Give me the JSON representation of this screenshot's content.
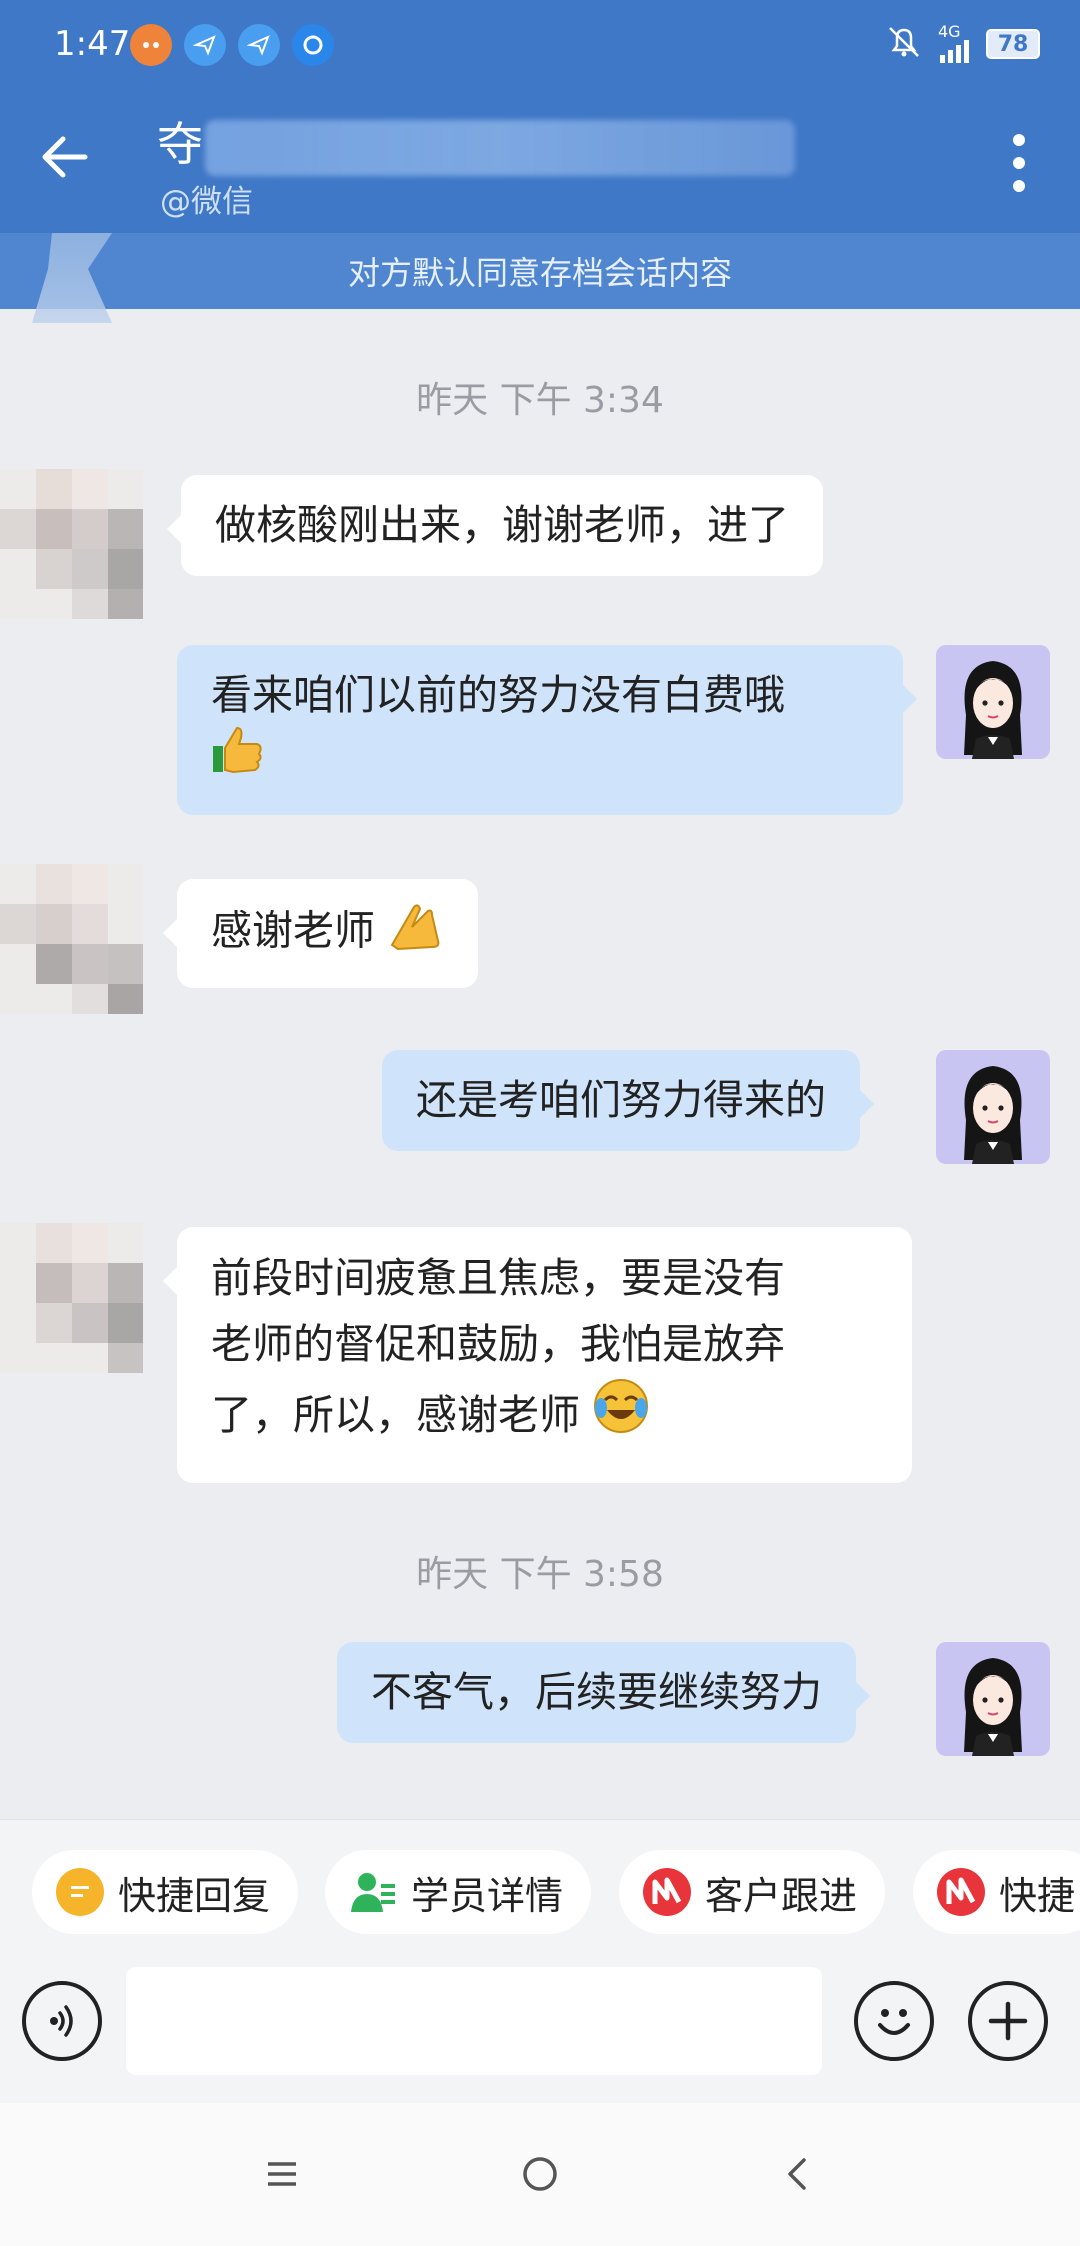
{
  "status_bar": {
    "time": "1:47",
    "network": "4G",
    "battery": "78"
  },
  "header": {
    "contact_name": "夺",
    "source": "@微信",
    "archive_notice": "对方默认同意存档会话内容"
  },
  "chat": {
    "dividers": [
      "昨天  下午 3:34",
      "昨天  下午 3:58"
    ],
    "messages": [
      {
        "direction": "in",
        "text": "做核酸刚出来，谢谢老师，进了"
      },
      {
        "direction": "out",
        "text": "看来咱们以前的努力没有白费哦",
        "emoji": "👍"
      },
      {
        "direction": "in",
        "text": "感谢老师",
        "emoji": "🙏"
      },
      {
        "direction": "out",
        "text": "还是考咱们努力得来的"
      },
      {
        "direction": "in",
        "line1": "前段时间疲惫且焦虑，要是没有",
        "line2": "老师的督促和鼓励，我怕是放弃",
        "line3": "了，所以，感谢老师",
        "emoji": "😭"
      },
      {
        "direction": "out",
        "text": "不客气，后续要继续努力"
      }
    ]
  },
  "quick_actions": [
    {
      "label": "快捷回复",
      "icon": "quick-reply-icon",
      "color": "#f6b42a"
    },
    {
      "label": "学员详情",
      "icon": "student-icon",
      "color": "#2fb35a"
    },
    {
      "label": "客户跟进",
      "icon": "follow-up-icon",
      "color": "#e8343b"
    },
    {
      "label": "快捷",
      "icon": "quick-icon",
      "color": "#e8343b"
    }
  ],
  "input": {
    "value": "",
    "placeholder": ""
  },
  "colors": {
    "header": "#3f78c6",
    "incoming_bubble": "#ffffff",
    "outgoing_bubble": "#cfe4fa",
    "background": "#ecedf1"
  }
}
